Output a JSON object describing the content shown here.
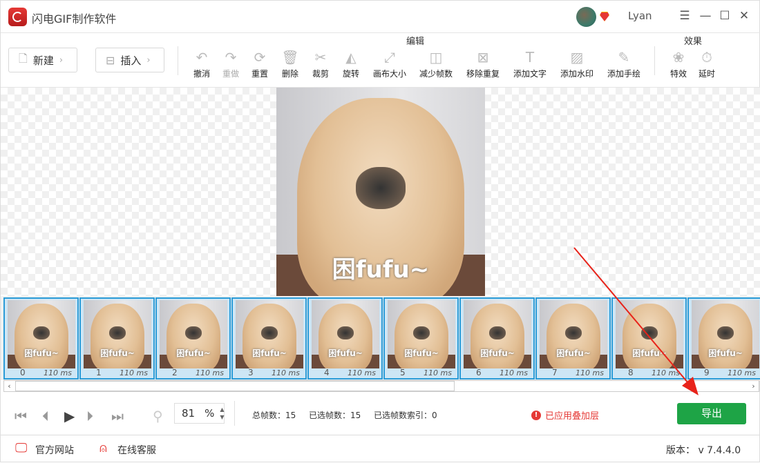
{
  "app": {
    "title": "闪电GIF制作软件",
    "user": "Lyan"
  },
  "toolbar": {
    "new_label": "新建",
    "insert_label": "插入",
    "edit_group": "编辑",
    "effect_group": "效果",
    "tools": [
      {
        "label": "撤消",
        "icon": "undo-icon",
        "glyph": "↶",
        "disabled": false
      },
      {
        "label": "重做",
        "icon": "redo-icon",
        "glyph": "↷",
        "disabled": true
      },
      {
        "label": "重置",
        "icon": "reset-icon",
        "glyph": "⟳",
        "disabled": false
      },
      {
        "label": "删除",
        "icon": "trash-icon",
        "glyph": "🗑",
        "disabled": false
      },
      {
        "label": "裁剪",
        "icon": "scissors-icon",
        "glyph": "✂",
        "disabled": false
      },
      {
        "label": "旋转",
        "icon": "flip-icon",
        "glyph": "◭",
        "disabled": false
      },
      {
        "label": "画布大小",
        "icon": "resize-icon",
        "glyph": "⤢",
        "disabled": false
      },
      {
        "label": "减少帧数",
        "icon": "reduce-frames-icon",
        "glyph": "◫",
        "disabled": false
      },
      {
        "label": "移除重复",
        "icon": "remove-duplicate-icon",
        "glyph": "⊠",
        "disabled": false
      },
      {
        "label": "添加文字",
        "icon": "text-icon",
        "glyph": "T",
        "disabled": false
      },
      {
        "label": "添加水印",
        "icon": "watermark-icon",
        "glyph": "▨",
        "disabled": false
      },
      {
        "label": "添加手绘",
        "icon": "pencil-icon",
        "glyph": "✎",
        "disabled": false
      },
      {
        "label": "特效",
        "icon": "effects-icon",
        "glyph": "❀",
        "disabled": false
      },
      {
        "label": "延时",
        "icon": "timer-icon",
        "glyph": "⏱",
        "disabled": false
      }
    ]
  },
  "preview": {
    "caption": "困fufu~"
  },
  "frames": [
    {
      "index": "0",
      "delay": "110 ms"
    },
    {
      "index": "1",
      "delay": "110 ms"
    },
    {
      "index": "2",
      "delay": "110 ms"
    },
    {
      "index": "3",
      "delay": "110 ms"
    },
    {
      "index": "4",
      "delay": "110 ms"
    },
    {
      "index": "5",
      "delay": "110 ms"
    },
    {
      "index": "6",
      "delay": "110 ms"
    },
    {
      "index": "7",
      "delay": "110 ms"
    },
    {
      "index": "8",
      "delay": "110 ms"
    },
    {
      "index": "9",
      "delay": "110 ms"
    }
  ],
  "controls": {
    "zoom_value": "81",
    "zoom_unit": "%",
    "total_frames": "总帧数：15",
    "selected_frames": "已选帧数：15",
    "selected_index": "已选帧数索引：0",
    "warning": "已应用叠加层",
    "export_label": "导出"
  },
  "footer": {
    "website": "官方网站",
    "support": "在线客服",
    "version": "版本： v 7.4.4.0"
  },
  "colors": {
    "accent": "#1ea446",
    "warning": "#e53935",
    "selection": "#2a9bd7"
  }
}
